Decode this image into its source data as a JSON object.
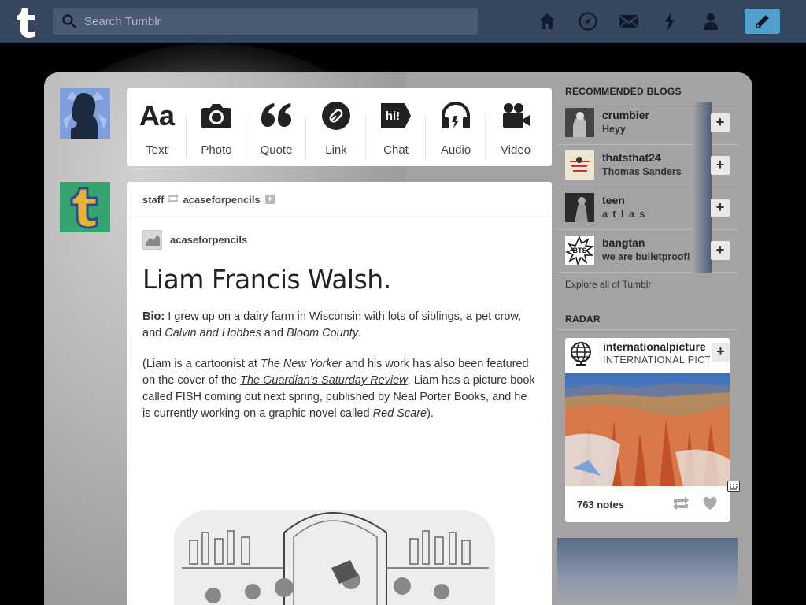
{
  "header": {
    "search_placeholder": "Search Tumblr",
    "nav_icons": [
      "home-icon",
      "explore-icon",
      "inbox-icon",
      "activity-icon",
      "account-icon"
    ],
    "compose_icon": "pencil-icon"
  },
  "post_types": [
    {
      "label": "Text",
      "glyph": "Aa"
    },
    {
      "label": "Photo",
      "glyph": "camera"
    },
    {
      "label": "Quote",
      "glyph": "❝"
    },
    {
      "label": "Link",
      "glyph": "link"
    },
    {
      "label": "Chat",
      "glyph": "hi!"
    },
    {
      "label": "Audio",
      "glyph": "headphones"
    },
    {
      "label": "Video",
      "glyph": "video"
    }
  ],
  "post": {
    "reblogged_by": "staff",
    "reblogged_from": "acaseforpencils",
    "author": "acaseforpencils",
    "title": "Liam Francis Walsh.",
    "bio_label": "Bio:",
    "bio_text_1": " I grew up on a dairy farm in Wisconsin with lots of siblings, a pet crow, and ",
    "bio_em_1": "Calvin and Hobbes",
    "bio_text_2": " and ",
    "bio_em_2": "Bloom County",
    "bio_text_3": ".",
    "p2_text_1": "(Liam is a cartoonist at ",
    "p2_em_1": "The New Yorker",
    "p2_text_2": " and his work has also been featured on the cover of the ",
    "p2_em_2": "The Guardian’s Saturday Review",
    "p2_text_3": ". Liam has a picture book called FISH coming out next spring, published by Neal Porter Books, and he is currently working on a graphic novel called ",
    "p2_em_3": "Red Scare",
    "p2_text_4": ")."
  },
  "sidebar": {
    "recommended_title": "RECOMMENDED BLOGS",
    "blogs": [
      {
        "name": "crumbier",
        "desc": "Heyy"
      },
      {
        "name": "thatsthat24",
        "desc": "Thomas Sanders"
      },
      {
        "name": "teen",
        "desc": "a t l a s"
      },
      {
        "name": "bangtan",
        "desc": "we are bulletproof!"
      }
    ],
    "explore_label": "Explore all of Tumblr",
    "radar_title": "RADAR",
    "radar": {
      "name": "internationalpicture",
      "desc": "INTERNATIONAL PICTURE",
      "notes": "763 notes"
    }
  },
  "colors": {
    "nav_bg": "#36465d",
    "compose_bg": "#529ecc",
    "panel_bg": "#a3a3a3"
  }
}
